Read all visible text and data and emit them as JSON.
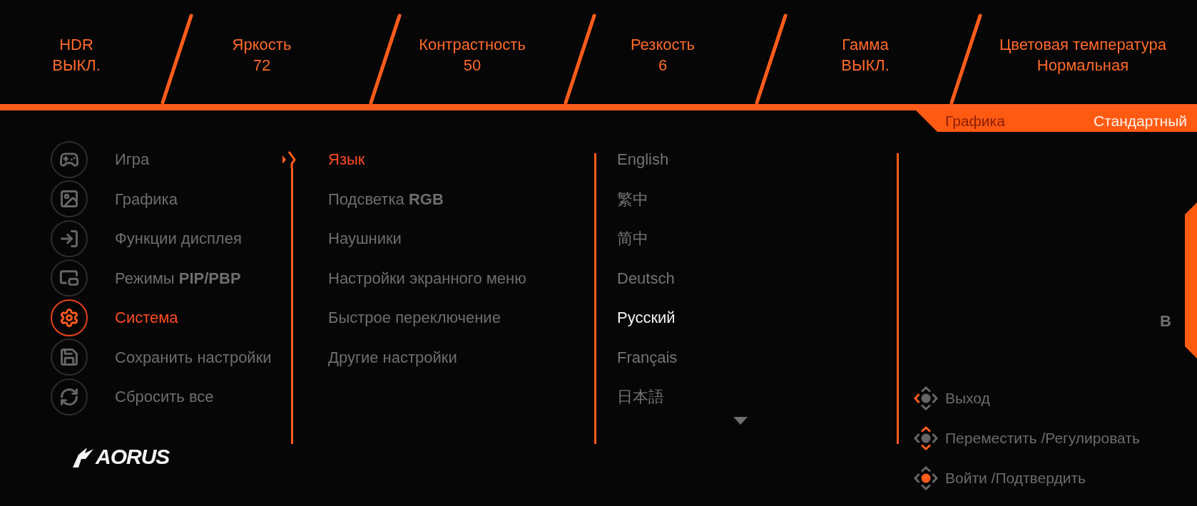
{
  "top_bar": {
    "settings": [
      {
        "label": "HDR",
        "value": "ВЫКЛ."
      },
      {
        "label": "Яркость",
        "value": "72"
      },
      {
        "label": "Контрастность",
        "value": "50"
      },
      {
        "label": "Резкость",
        "value": "6"
      },
      {
        "label": "Гамма",
        "value": "ВЫКЛ."
      },
      {
        "label": "Цветовая температура",
        "value": "Нормальная"
      }
    ]
  },
  "mode_tab": {
    "label": "Графика",
    "value": "Стандартный"
  },
  "menu": {
    "items": [
      {
        "label": "Игра",
        "selected": false
      },
      {
        "label": "Графика",
        "selected": false
      },
      {
        "label": "Функции дисплея",
        "selected": false
      },
      {
        "label": "Режимы **PIP/PBP**",
        "selected": false
      },
      {
        "label": "Система",
        "selected": true
      },
      {
        "label": "Сохранить настройки",
        "selected": false
      },
      {
        "label": "Сбросить все",
        "selected": false
      }
    ]
  },
  "submenu": {
    "items": [
      {
        "label": "Язык",
        "selected": true
      },
      {
        "label": "Подсветка **RGB**",
        "selected": false
      },
      {
        "label": "Наушники",
        "selected": false
      },
      {
        "label": "Настройки экранного меню",
        "selected": false
      },
      {
        "label": "Быстрое переключение",
        "selected": false
      },
      {
        "label": "Другие настройки",
        "selected": false
      }
    ]
  },
  "languages": {
    "items": [
      {
        "label": "English",
        "selected": false
      },
      {
        "label": "繁中",
        "selected": false
      },
      {
        "label": "简中",
        "selected": false
      },
      {
        "label": "Deutsch",
        "selected": false
      },
      {
        "label": "Русский",
        "selected": true
      },
      {
        "label": "Français",
        "selected": false
      },
      {
        "label": "日本語",
        "selected": false
      }
    ],
    "more_below": true
  },
  "side_label": "B",
  "hints": [
    {
      "kind": "exit",
      "text": "Выход"
    },
    {
      "kind": "move",
      "text": "Переместить /Регулировать"
    },
    {
      "kind": "enter",
      "text": "Войти /Подтвердить"
    }
  ],
  "logo": {
    "text": "AORUS"
  }
}
